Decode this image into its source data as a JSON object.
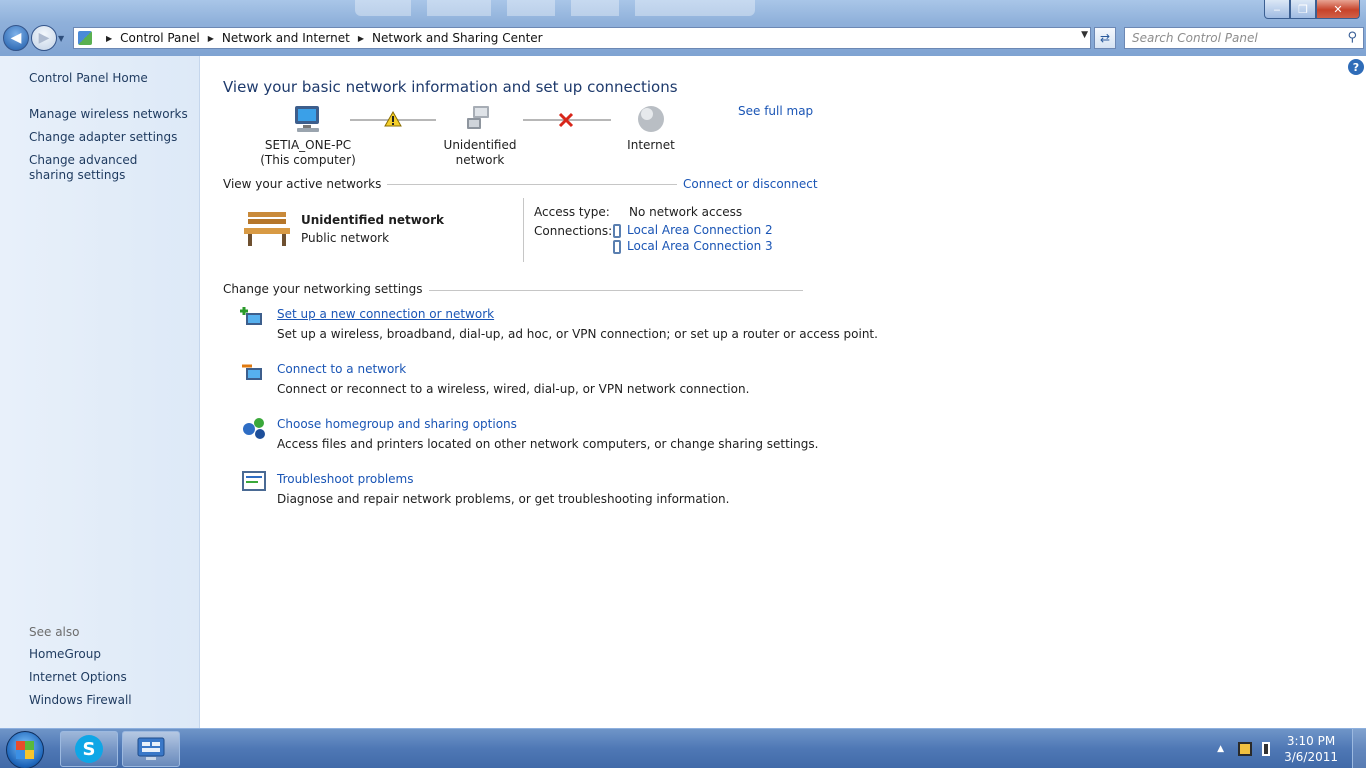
{
  "window": {
    "breadcrumb": [
      "Control Panel",
      "Network and Internet",
      "Network and Sharing Center"
    ],
    "search_placeholder": "Search Control Panel",
    "buttons": {
      "minimize": "‒",
      "maximize": "❐",
      "close": "✕"
    }
  },
  "sidebar": {
    "home": "Control Panel Home",
    "tasks": [
      "Manage wireless networks",
      "Change adapter settings",
      "Change advanced sharing settings"
    ],
    "see_also_label": "See also",
    "see_also": [
      "HomeGroup",
      "Internet Options",
      "Windows Firewall"
    ]
  },
  "main": {
    "title": "View your basic network information and set up connections",
    "see_full_map": "See full map",
    "map": {
      "computer_name": "SETIA_ONE-PC",
      "computer_sub": "(This computer)",
      "network": "Unidentified network",
      "internet": "Internet"
    },
    "active_networks": {
      "heading": "View your active networks",
      "connect_link": "Connect or disconnect",
      "network_name": "Unidentified network",
      "network_type": "Public network",
      "access_type_label": "Access type:",
      "access_type_value": "No network access",
      "connections_label": "Connections:",
      "connections": [
        "Local Area Connection 2",
        "Local Area Connection 3"
      ]
    },
    "settings": {
      "heading": "Change your networking settings",
      "tasks": [
        {
          "title": "Set up a new connection or network",
          "desc": "Set up a wireless, broadband, dial-up, ad hoc, or VPN connection; or set up a router or access point."
        },
        {
          "title": "Connect to a network",
          "desc": "Connect or reconnect to a wireless, wired, dial-up, or VPN network connection."
        },
        {
          "title": "Choose homegroup and sharing options",
          "desc": "Access files and printers located on other network computers, or change sharing settings."
        },
        {
          "title": "Troubleshoot problems",
          "desc": "Diagnose and repair network problems, or get troubleshooting information."
        }
      ]
    }
  },
  "taskbar": {
    "time": "3:10 PM",
    "date": "3/6/2011",
    "skype_glyph": "S"
  },
  "colors": {
    "link": "#1a55b5",
    "title": "#1e3a6c",
    "sidebar": "#e8f0fa",
    "taskbar": "#4f78b5"
  }
}
